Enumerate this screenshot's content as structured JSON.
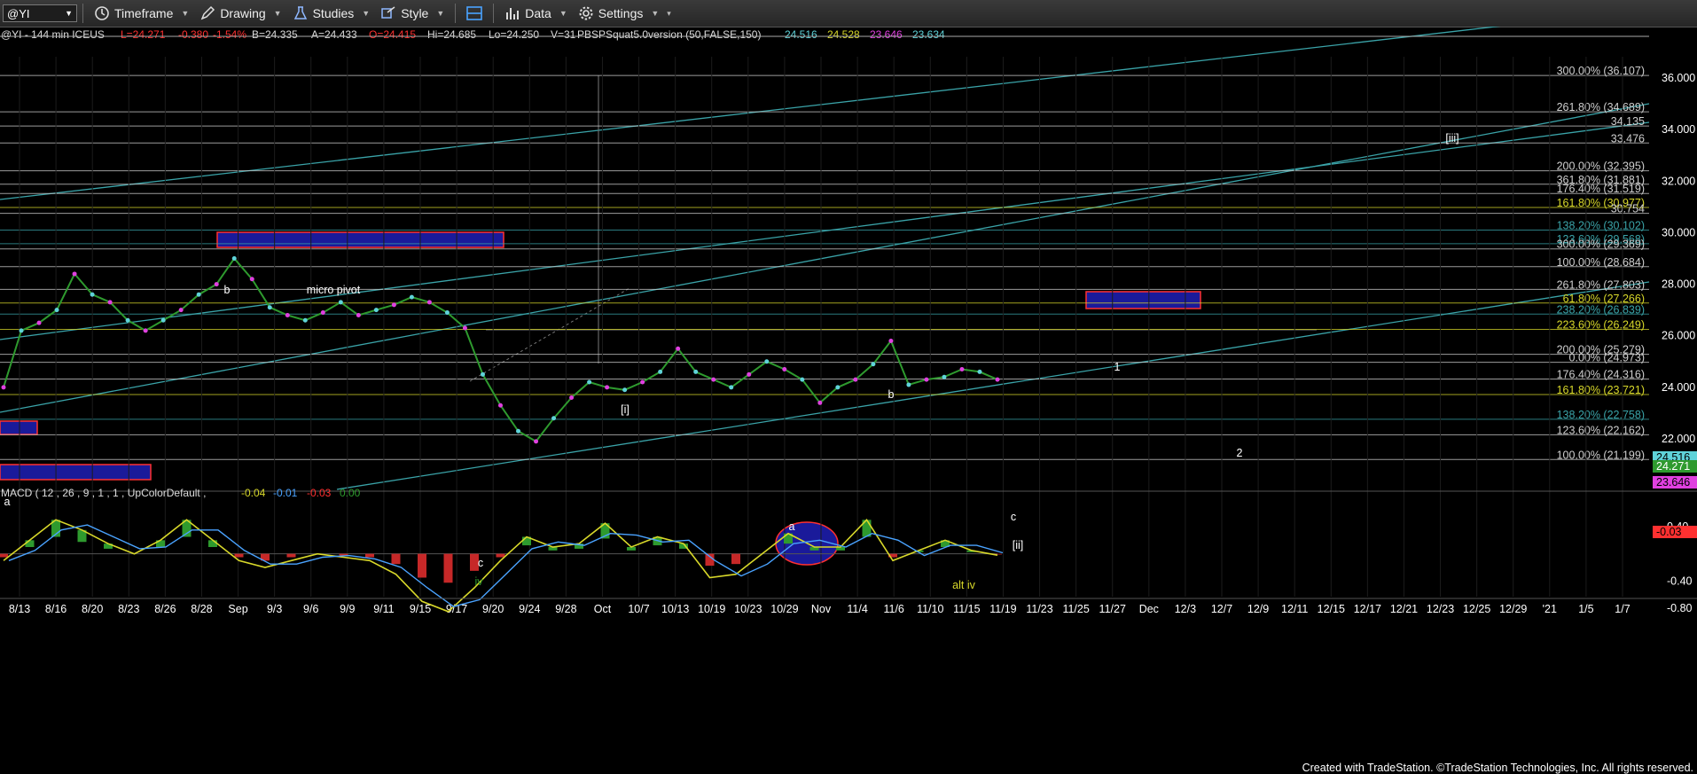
{
  "toolbar": {
    "symbol": "@YI",
    "items": [
      {
        "key": "timeframe",
        "label": "Timeframe"
      },
      {
        "key": "drawing",
        "label": "Drawing"
      },
      {
        "key": "studies",
        "label": "Studies"
      },
      {
        "key": "style",
        "label": "Style"
      },
      {
        "key": "data",
        "label": "Data"
      },
      {
        "key": "settings",
        "label": "Settings"
      }
    ]
  },
  "header": {
    "symbol_info": "@YI - 144 min  ICEUS",
    "last": "L=24.271",
    "change": "-0.380",
    "change_pct": "-1.54%",
    "bid": "B=24.335",
    "ask": "A=24.433",
    "open": "O=24.415",
    "high": "Hi=24.685",
    "low": "Lo=24.250",
    "volume": "V=31",
    "study": "PBSPSquat5.0version (50,FALSE,150)",
    "study_vals": [
      "24.516",
      "24.528",
      "23.646",
      "23.634"
    ]
  },
  "macd_header": {
    "label": "MACD ( 12 , 26 , 9 , 1 , 1 , UpColorDefault  ,",
    "vals": [
      "-0.04",
      "-0.01",
      "-0.03",
      "0.00"
    ]
  },
  "footer": "Created with TradeStation. ©TradeStation Technologies, Inc. All rights reserved.",
  "colors": {
    "cyan": "#5fd3d9",
    "green": "#2e9a2e",
    "yellow": "#d8d82a",
    "red": "#ff3030",
    "magenta": "#e040e0",
    "blue_box": "#1a1a9a"
  },
  "chart_data": {
    "type": "line",
    "title": "@YI - 144 min  ICEUS",
    "y_ticks": [
      "36.000",
      "34.000",
      "32.000",
      "30.000",
      "28.000",
      "26.000",
      "24.000",
      "22.000"
    ],
    "macd_y_ticks": [
      "0.40",
      "-0.40",
      "-0.80"
    ],
    "x_ticks": [
      "8/13",
      "8/16",
      "8/20",
      "8/23",
      "8/26",
      "8/28",
      "Sep",
      "9/3",
      "9/6",
      "9/9",
      "9/11",
      "9/15",
      "9/17",
      "9/20",
      "9/24",
      "9/28",
      "Oct",
      "10/7",
      "10/13",
      "10/19",
      "10/23",
      "10/29",
      "Nov",
      "11/4",
      "11/6",
      "11/10",
      "11/15",
      "11/19",
      "11/23",
      "11/25",
      "11/27",
      "Dec",
      "12/3",
      "12/7",
      "12/9",
      "12/11",
      "12/15",
      "12/17",
      "12/21",
      "12/23",
      "12/25",
      "12/29",
      "'21",
      "1/5",
      "1/7"
    ],
    "price_label_last": "24.271",
    "price_label_study": "24.516",
    "price_label_low": "23.646",
    "macd_label": "-0.03",
    "ylim": [
      20.5,
      37.2
    ],
    "series": [
      {
        "values": [
          24.0,
          26.2,
          26.5,
          27.0,
          28.4,
          27.6,
          27.3,
          26.6,
          26.2,
          26.6,
          27.0,
          27.6,
          28.0,
          29.0,
          28.2,
          27.1,
          26.8,
          26.6,
          26.9,
          27.3,
          26.8,
          27.0,
          27.2,
          27.5,
          27.3,
          26.9,
          26.3,
          24.5,
          23.3,
          22.3,
          21.9,
          22.8,
          23.6,
          24.2,
          24.0,
          23.9,
          24.2,
          24.6,
          25.5,
          24.6,
          24.3,
          24.0,
          24.5,
          25.0,
          24.7,
          24.3,
          23.4,
          24.0,
          24.3,
          24.9,
          25.8,
          24.1,
          24.3,
          24.4,
          24.7,
          24.6,
          24.3
        ]
      }
    ],
    "macd": [
      -0.1,
      0.2,
      0.5,
      0.35,
      0.15,
      0.0,
      0.2,
      0.5,
      0.2,
      -0.1,
      -0.2,
      -0.1,
      0.0,
      -0.05,
      -0.1,
      -0.3,
      -0.7,
      -0.85,
      -0.5,
      -0.1,
      0.25,
      0.1,
      0.15,
      0.45,
      0.1,
      0.25,
      0.15,
      -0.35,
      -0.3,
      0.0,
      0.3,
      0.1,
      0.1,
      0.5,
      -0.1,
      0.05,
      0.2,
      0.05,
      -0.02
    ],
    "fib_levels": [
      {
        "label": "300.00% (36.107)",
        "price": 36.1,
        "color": "#cfcfcf"
      },
      {
        "label": "261.80% (34.689)",
        "price": 34.69,
        "color": "#cfcfcf"
      },
      {
        "label": "34.135",
        "price": 34.14,
        "color": "#cfcfcf"
      },
      {
        "label": "33.476",
        "price": 33.48,
        "color": "#cfcfcf"
      },
      {
        "label": "200.00% (32.395)",
        "price": 32.4,
        "color": "#cfcfcf"
      },
      {
        "label": "361.80% (31.881)",
        "price": 31.88,
        "color": "#cfcfcf"
      },
      {
        "label": "176.40% (31.519)",
        "price": 31.52,
        "color": "#cfcfcf"
      },
      {
        "label": "161.80% (30.977)",
        "price": 30.98,
        "color": "#d8d82a"
      },
      {
        "label": "30.754",
        "price": 30.75,
        "color": "#cfcfcf"
      },
      {
        "label": "138.20% (30.102)",
        "price": 30.1,
        "color": "#3aa3a8"
      },
      {
        "label": "123.60% (29.568)",
        "price": 29.57,
        "color": "#3aa3a8"
      },
      {
        "label": "300.00% (29.369)",
        "price": 29.37,
        "color": "#cfcfcf"
      },
      {
        "label": "100.00% (28.684)",
        "price": 28.68,
        "color": "#cfcfcf"
      },
      {
        "label": "261.80% (27.803)",
        "price": 27.8,
        "color": "#cfcfcf"
      },
      {
        "label": "61.80% (27.266)",
        "price": 27.27,
        "color": "#d8d82a"
      },
      {
        "label": "238.20% (26.839)",
        "price": 26.84,
        "color": "#3aa3a8"
      },
      {
        "label": "223.60% (26.249)",
        "price": 26.25,
        "color": "#d8d82a"
      },
      {
        "label": "200.00% (25.279)",
        "price": 25.28,
        "color": "#cfcfcf"
      },
      {
        "label": "0.00% (24.973)",
        "price": 24.97,
        "color": "#cfcfcf"
      },
      {
        "label": "176.40% (24.316)",
        "price": 24.32,
        "color": "#cfcfcf"
      },
      {
        "label": "161.80% (23.721)",
        "price": 23.72,
        "color": "#d8d82a"
      },
      {
        "label": "138.20% (22.758)",
        "price": 22.76,
        "color": "#3aa3a8"
      },
      {
        "label": "123.60% (22.162)",
        "price": 22.16,
        "color": "#cfcfcf"
      },
      {
        "label": "100.00% (21.199)",
        "price": 21.2,
        "color": "#cfcfcf"
      }
    ],
    "annotations": [
      {
        "text": "b",
        "color": "#fff"
      },
      {
        "text": "micro pivot",
        "color": "#fff"
      },
      {
        "text": "a",
        "color": "#fff"
      },
      {
        "text": "[i]",
        "color": "#fff"
      },
      {
        "text": "c",
        "color": "#fff"
      },
      {
        "text": "iv",
        "color": "#2e9a2e"
      },
      {
        "text": "a",
        "color": "#fff"
      },
      {
        "text": "b",
        "color": "#fff"
      },
      {
        "text": "c",
        "color": "#fff"
      },
      {
        "text": "[ii]",
        "color": "#fff"
      },
      {
        "text": "alt iv",
        "color": "#d8d82a"
      },
      {
        "text": "1",
        "color": "#fff"
      },
      {
        "text": "2",
        "color": "#fff"
      },
      {
        "text": "[iii]",
        "color": "#fff"
      }
    ]
  }
}
